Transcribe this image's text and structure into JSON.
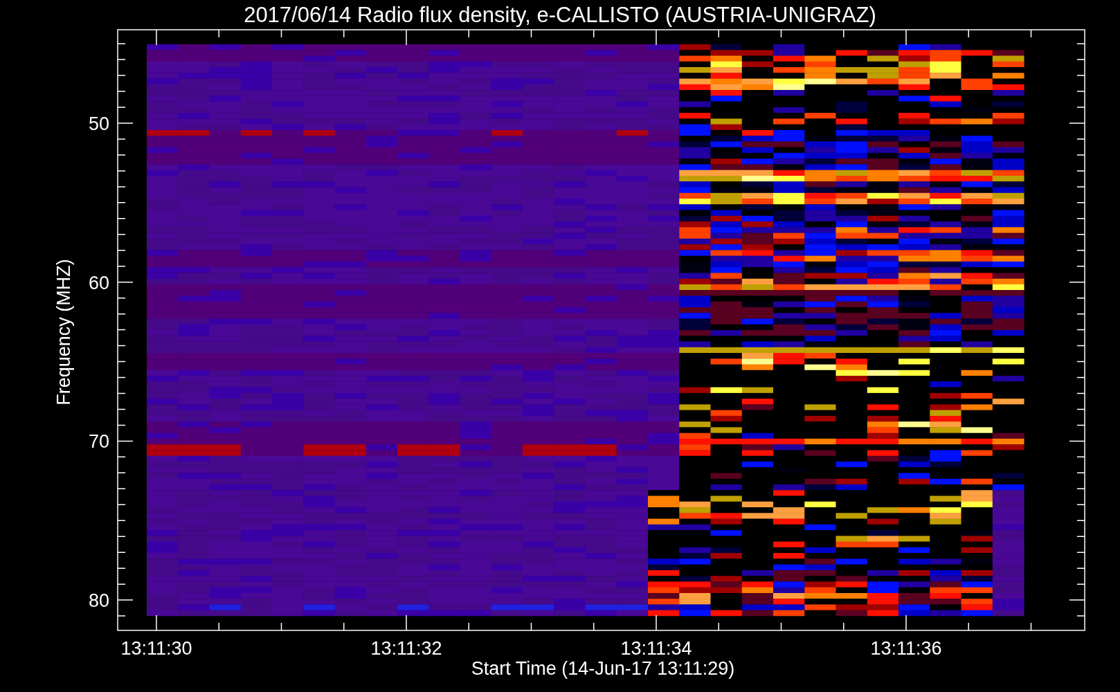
{
  "title": "2017/06/14  Radio flux density, e-CALLISTO (AUSTRIA-UNIGRAZ)",
  "plot": {
    "ylabel": "Frequency (MHZ)",
    "xlabel": "Start Time (14-Jun-17 13:11:29)",
    "yticks": [
      "50",
      "60",
      "70",
      "80"
    ],
    "xticks": [
      "13:11:30",
      "13:11:32",
      "13:11:34",
      "13:11:36"
    ]
  }
}
